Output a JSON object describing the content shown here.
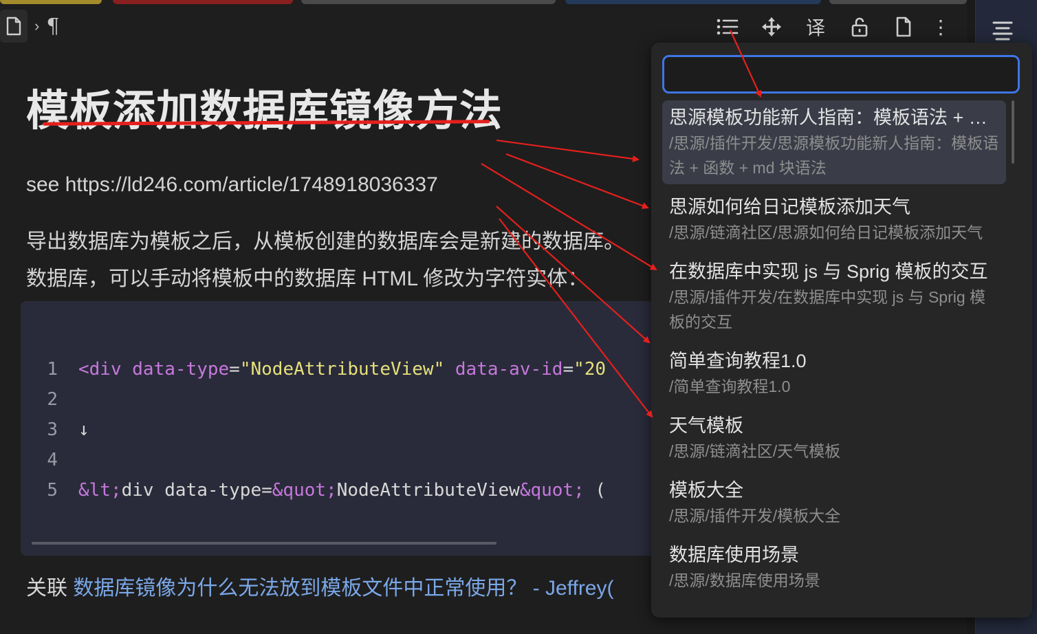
{
  "tabs": [
    {
      "color": "#a48b2c"
    },
    {
      "color": "#8a1f1f"
    },
    {
      "color": "#4a4a4a"
    },
    {
      "color": "#233a5a"
    },
    {
      "color": "#4a4a4a"
    }
  ],
  "breadcrumb": {
    "separator": "›",
    "block_glyph": "¶"
  },
  "toolbar": {
    "translate_label": "译",
    "more_label": "⋮"
  },
  "document": {
    "title": "模板添加数据库镜像方法",
    "see_line": "see https://ld246.com/article/1748918036337",
    "desc_line1": "导出数据库为模板之后，从模板创建的数据库会是新建的数据库。",
    "desc_line2": "数据库，可以手动将模板中的数据库 HTML 修改为字符实体：",
    "code": {
      "line_numbers": [
        "1",
        "2",
        "3",
        "4",
        "5"
      ],
      "line1": {
        "open": "<div",
        "attr1": "data-type",
        "eq1": "=",
        "val1": "\"NodeAttributeView\"",
        "attr2": "data-av-id",
        "eq2": "=",
        "val2": "\"20"
      },
      "line3": "↓",
      "line5": {
        "e1": "&lt;",
        "t1": "div data-type=",
        "e2": "&quot;",
        "t2": "NodeAttributeView",
        "e3": "&quot;",
        "t3": " ("
      }
    },
    "related_label": "关联",
    "related_link": "数据库镜像为什么无法放到模板文件中正常使用？ - Jeffrey("
  },
  "popup": {
    "search_value": "",
    "items": [
      {
        "title": "思源模板功能新人指南：模板语法 + …",
        "path": "/思源/插件开发/思源模板功能新人指南：模板语法 + 函数 + md 块语法"
      },
      {
        "title": "思源如何给日记模板添加天气",
        "path": "/思源/链滴社区/思源如何给日记模板添加天气"
      },
      {
        "title": "在数据库中实现 js 与 Sprig 模板的交互",
        "path": "/思源/插件开发/在数据库中实现 js 与 Sprig 模板的交互"
      },
      {
        "title": "简单查询教程1.0",
        "path": "/简单查询教程1.0"
      },
      {
        "title": "天气模板",
        "path": "/思源/链滴社区/天气模板"
      },
      {
        "title": "模板大全",
        "path": "/思源/插件开发/模板大全"
      },
      {
        "title": "数据库使用场景",
        "path": "/思源/数据库使用场景"
      }
    ]
  },
  "colors": {
    "accent": "#3f76e6",
    "annotation": "#e5201d",
    "link": "#7aa7e8"
  }
}
